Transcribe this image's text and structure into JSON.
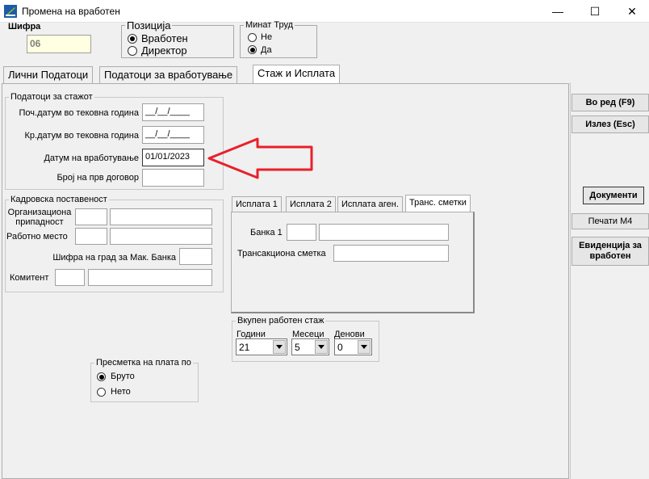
{
  "window": {
    "title": "Промена на вработен",
    "minimize": "—",
    "maximize": "☐",
    "close": "✕",
    "icon": "app-logo-icon"
  },
  "header": {
    "sifra_label": "Шифра",
    "sifra_value": "06",
    "pozicija": {
      "legend": "Позиција",
      "options": [
        "Вработен",
        "Директор"
      ],
      "selected": "Вработен"
    },
    "minat_trud": {
      "legend": "Минат Труд",
      "options": [
        "Не",
        "Да"
      ],
      "selected": "Да"
    }
  },
  "tabs": [
    {
      "label": "Лични Податоци",
      "active": false
    },
    {
      "label": "Податоци за вработување",
      "active": false
    },
    {
      "label": "Стаж и Исплата",
      "active": true
    }
  ],
  "staz": {
    "legend": "Податоци за стажот",
    "rows": [
      {
        "label": "Поч.датум во тековна година",
        "value": "__/__/____"
      },
      {
        "label": "Кр.датум во тековна година",
        "value": "__/__/____"
      },
      {
        "label": "Датум на вработување",
        "value": "01/01/2023"
      },
      {
        "label": "Број на прв договор",
        "value": ""
      }
    ]
  },
  "kadrovska": {
    "legend": "Кадровска поставеност",
    "org_label": "Организациона припадност",
    "rabotno_label": "Работно место",
    "sifra_grad_label": "Шифра на град за Мак. Банка",
    "komitent_label": "Комитент"
  },
  "isplata_tabs": [
    {
      "label": "Исплата 1",
      "active": false
    },
    {
      "label": "Исплата 2",
      "active": false
    },
    {
      "label": "Исплата аген.",
      "active": false
    },
    {
      "label": "Транс. сметки",
      "active": true
    }
  ],
  "isplata": {
    "banka_label": "Банка 1",
    "transakciona_label": "Трансакциона сметка"
  },
  "vkupen": {
    "legend": "Вкупен работен стаж",
    "godini_label": "Години",
    "meseci_label": "Месеци",
    "denovi_label": "Денови",
    "godini_value": "21",
    "meseci_value": "5",
    "denovi_value": "0"
  },
  "presmetka": {
    "legend": "Пресметка на плата по",
    "options": [
      "Бруто",
      "Нето"
    ],
    "selected": "Бруто"
  },
  "side_buttons": {
    "vo_red": "Во ред (F9)",
    "izlez": "Излез (Esc)",
    "dokumenti": "Документи",
    "pecati": "Печати М4",
    "evidencija": "Евиденција за вработен"
  },
  "colors": {
    "arrow": "#e8202a",
    "window_bg": "#f0f0f0",
    "highlight_field": "#ffffe1"
  }
}
